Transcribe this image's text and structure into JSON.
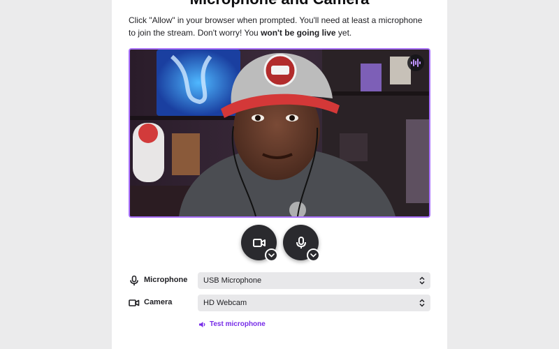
{
  "page": {
    "heading": "Microphone and Camera",
    "intro_part1": "Click \"Allow\" in your browser when prompted. You'll need at least a microphone to join the stream. Don't worry! You ",
    "intro_bold": "won't be going live",
    "intro_part2": " yet."
  },
  "preview": {
    "audio_indicator_icon": "audio-waveform-icon"
  },
  "controls": {
    "camera_button_icon": "video-camera-icon",
    "mic_button_icon": "microphone-icon",
    "dropdown_icon": "chevron-down-icon"
  },
  "settings": {
    "microphone_label": "Microphone",
    "microphone_value": "USB Microphone",
    "camera_label": "Camera",
    "camera_value": "HD Webcam"
  },
  "test_link": {
    "label": "Test microphone",
    "icon": "speaker-icon"
  },
  "colors": {
    "accent": "#772ce8",
    "preview_border": "#a970ff",
    "button_dark": "#2a2a2e",
    "select_bg": "#e8e8ea",
    "page_bg": "#ebebec"
  }
}
